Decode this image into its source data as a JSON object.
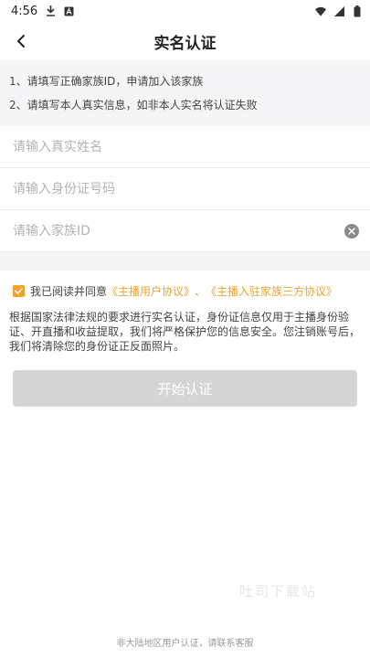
{
  "status_bar": {
    "time": "4:56",
    "battery": "battery-icon"
  },
  "nav": {
    "title": "实名认证",
    "back_icon": "chevron-left-icon"
  },
  "notice": {
    "line1": "1、请填写正确家族ID，申请加入该家族",
    "line2": "2、请填写本人真实信息，如非本人实名将认证失败"
  },
  "form": {
    "name_placeholder": "请输入真实姓名",
    "id_card_placeholder": "请输入身份证号码",
    "family_id_placeholder": "请输入家族ID"
  },
  "agreement": {
    "prefix": "我已阅读并同意",
    "link1": "《主播用户协议》",
    "sep": "、",
    "link2": "《主播入驻家族三方协议》"
  },
  "description": "根据国家法律法规的要求进行实名认证，身份证信息仅用于主播身份验证、开直播和收益提取，我们将严格保护您的信息安全。您注销账号后，我们将清除您的身份证正反面照片。",
  "start_button": "开始认证",
  "watermark": "吐司下载站",
  "footer": "非大陆地区用户认证，请联系客服",
  "colors": {
    "accent": "#f0a22a",
    "button_disabled": "#d5d5d5",
    "notice_bg": "#f5f5f7"
  }
}
